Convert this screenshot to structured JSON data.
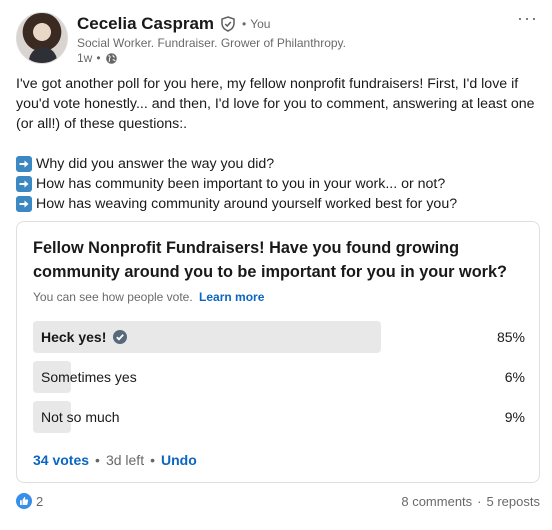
{
  "author": {
    "name": "Cecelia Caspram",
    "degree": "You",
    "headline": "Social Worker. Fundraiser. Grower of Philanthropy.",
    "time": "1w",
    "more_label": "···"
  },
  "post": {
    "paragraph": "I've got another poll for you here, my fellow nonprofit fundraisers! First, I'd love if you'd vote honestly... and then, I'd love for you to comment, answering at least one (or all!) of these questions:.",
    "questions": [
      "Why did you answer the way you did?",
      "How has community been important to you in your work... or not?",
      "How has weaving community around yourself worked best for you?"
    ]
  },
  "poll": {
    "question": "Fellow Nonprofit Fundraisers! Have you found growing community around you to be important for you in your work?",
    "visibility_note": "You can see how people vote.",
    "learn_more": "Learn more",
    "options": [
      {
        "label": "Heck yes!",
        "percent_text": "85%",
        "percent": 85,
        "selected": true
      },
      {
        "label": "Sometimes yes",
        "percent_text": "6%",
        "percent": 6,
        "selected": false
      },
      {
        "label": "Not so much",
        "percent_text": "9%",
        "percent": 9,
        "selected": false
      }
    ],
    "votes": "34 votes",
    "time_left": "3d left",
    "undo": "Undo"
  },
  "social": {
    "reaction_count": "2",
    "comments": "8 comments",
    "reposts": "5 reposts"
  },
  "colors": {
    "link_blue": "#0a66c2",
    "bar_fill": "#e8e8e8",
    "arrow_blue": "#3b88c3"
  }
}
